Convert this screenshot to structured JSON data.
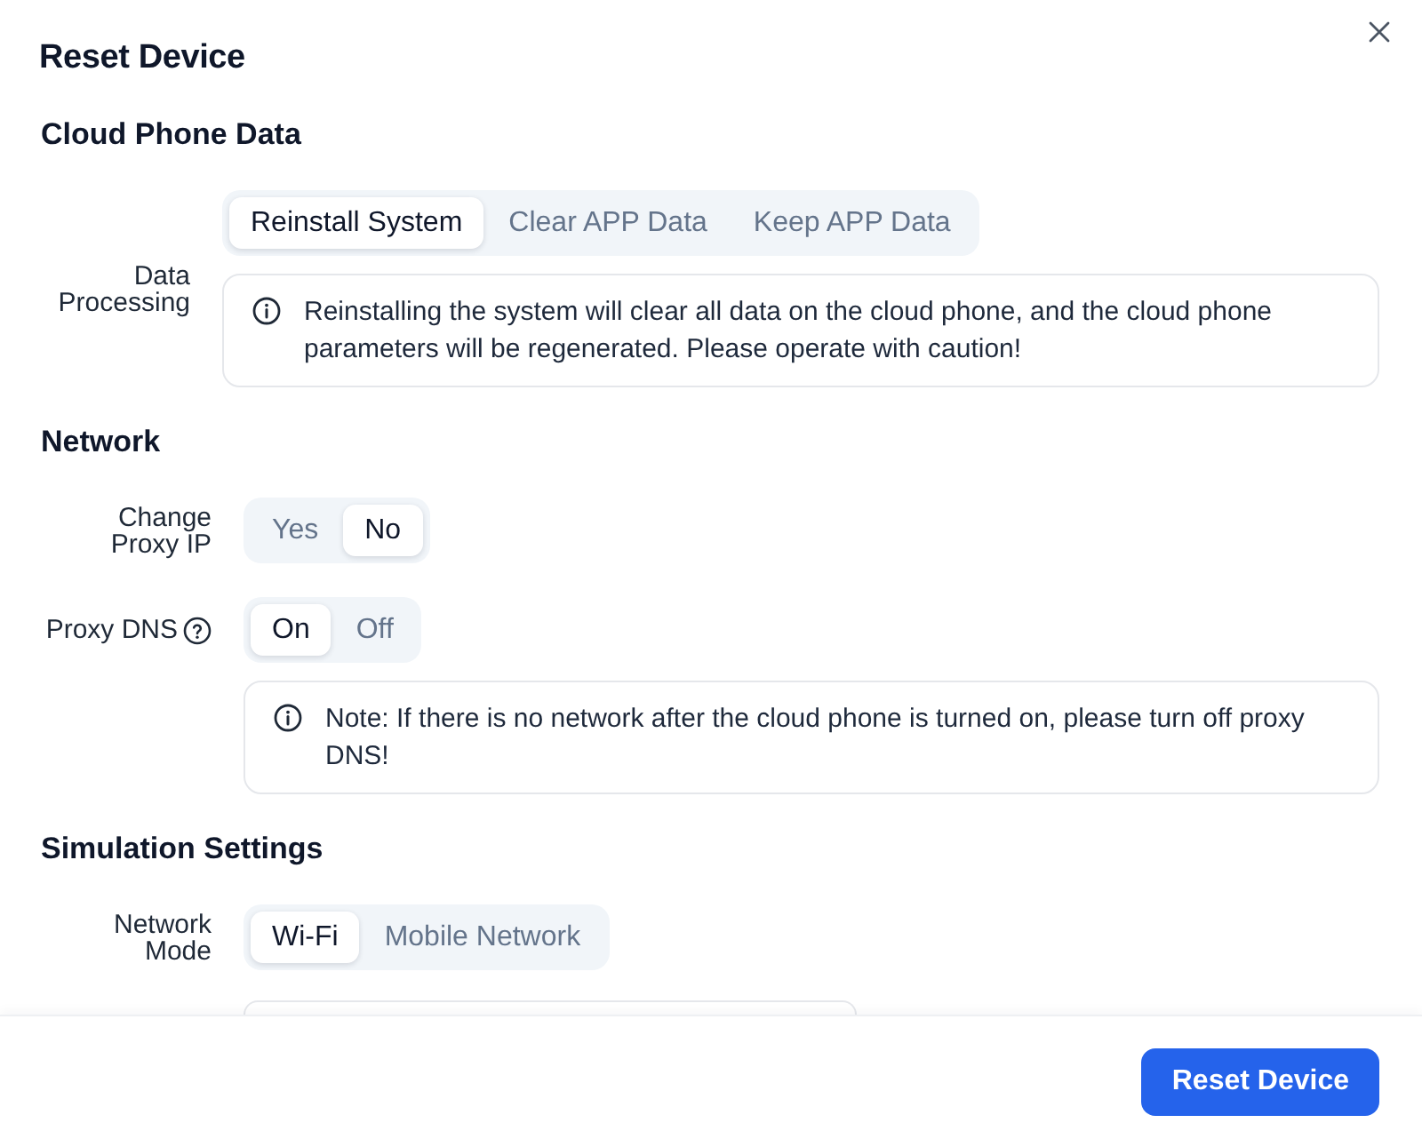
{
  "dialog": {
    "title": "Reset Device"
  },
  "sections": [
    {
      "title": "Cloud Phone Data",
      "rows": [
        {
          "kind": "choice",
          "label": "Data Processing",
          "help": false,
          "options": [
            {
              "label": "Reinstall System",
              "selected": true
            },
            {
              "label": "Clear APP Data",
              "selected": false
            },
            {
              "label": "Keep APP Data",
              "selected": false
            }
          ],
          "note": "Reinstalling the system will clear all data on the cloud phone, and the cloud phone parameters will be regenerated. Please operate with caution!"
        }
      ]
    },
    {
      "title": "Network",
      "rows": [
        {
          "kind": "choice",
          "label": "Change Proxy IP",
          "help": false,
          "options": [
            {
              "label": "Yes",
              "selected": false
            },
            {
              "label": "No",
              "selected": true
            }
          ]
        },
        {
          "kind": "choice",
          "label": "Proxy DNS",
          "help": true,
          "options": [
            {
              "label": "On",
              "selected": true
            },
            {
              "label": "Off",
              "selected": false
            }
          ]
        },
        {
          "kind": "note",
          "text": "Note: If there is no network after the cloud phone is turned on, please turn off proxy DNS!"
        }
      ]
    },
    {
      "title": "Simulation Settings",
      "rows": [
        {
          "kind": "choice",
          "label": "Network Mode",
          "help": false,
          "options": [
            {
              "label": "Wi-Fi",
              "selected": true
            },
            {
              "label": "Mobile Network",
              "selected": false
            }
          ]
        }
      ]
    }
  ],
  "footer": {
    "button": "Reset Device"
  }
}
